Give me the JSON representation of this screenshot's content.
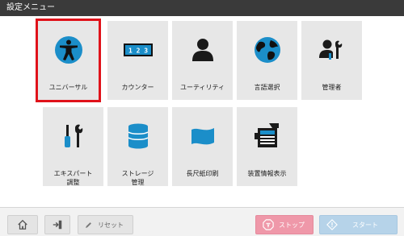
{
  "header": {
    "title": "設定メニュー"
  },
  "menu": {
    "tiles": [
      {
        "label": "ユニバーサル",
        "icon": "accessibility-icon",
        "selected": true
      },
      {
        "label": "カウンター",
        "icon": "counter-icon"
      },
      {
        "label": "ユーティリティ",
        "icon": "user-icon"
      },
      {
        "label": "言語選択",
        "icon": "globe-icon"
      },
      {
        "label": "管理者",
        "icon": "admin-icon"
      },
      {
        "label": "エキスパート\n調整",
        "icon": "screwdriver-wrench-icon"
      },
      {
        "label": "ストレージ\n管理",
        "icon": "storage-icon"
      },
      {
        "label": "長尺紙印刷",
        "icon": "long-paper-icon"
      },
      {
        "label": "装置情報表示",
        "icon": "device-info-icon"
      }
    ],
    "counter_digits": "1 2 3"
  },
  "footer": {
    "reset_label": "リセット",
    "stop_label": "ストップ",
    "start_label": "スタート"
  },
  "colors": {
    "accent_blue": "#1b8ec9",
    "selection": "#e0121a",
    "stop": "#ef98a9",
    "start": "#b6d3e9"
  }
}
